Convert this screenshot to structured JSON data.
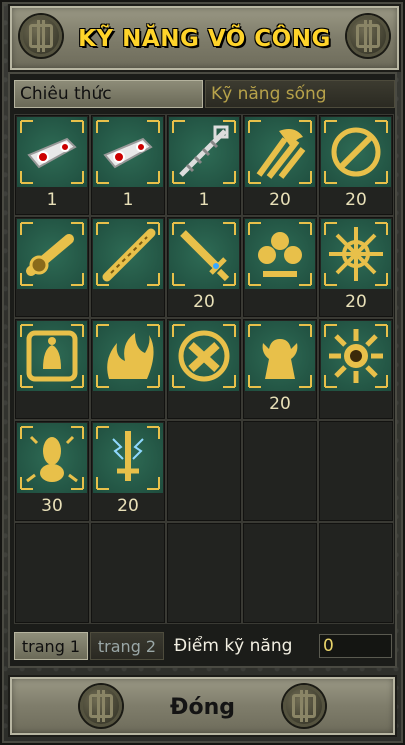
{
  "window": {
    "title": "KỸ NĂNG VÕ CÔNG"
  },
  "tabs": [
    {
      "label": "Chiêu thức",
      "active": true
    },
    {
      "label": "Kỹ năng sống",
      "active": false
    }
  ],
  "skills": [
    {
      "icon": "scroll-icon",
      "level": "1"
    },
    {
      "icon": "scroll-icon",
      "level": "1"
    },
    {
      "icon": "chain-blade-icon",
      "level": "1"
    },
    {
      "icon": "wave-slash-icon",
      "level": "20"
    },
    {
      "icon": "circle-slash-icon",
      "level": "20"
    },
    {
      "icon": "golden-flute-icon",
      "level": ""
    },
    {
      "icon": "staff-icon",
      "level": ""
    },
    {
      "icon": "sword-icon",
      "level": "20"
    },
    {
      "icon": "lotus-icon",
      "level": ""
    },
    {
      "icon": "burst-icon",
      "level": "20"
    },
    {
      "icon": "bell-icon",
      "level": ""
    },
    {
      "icon": "flame-icon",
      "level": ""
    },
    {
      "icon": "cross-circle-icon",
      "level": ""
    },
    {
      "icon": "statue-icon",
      "level": "20"
    },
    {
      "icon": "sun-icon",
      "level": ""
    },
    {
      "icon": "spirit-icon",
      "level": "30"
    },
    {
      "icon": "lightning-sword-icon",
      "level": "20"
    },
    {
      "icon": "",
      "level": ""
    },
    {
      "icon": "",
      "level": ""
    },
    {
      "icon": "",
      "level": ""
    },
    {
      "icon": "",
      "level": ""
    },
    {
      "icon": "",
      "level": ""
    },
    {
      "icon": "",
      "level": ""
    },
    {
      "icon": "",
      "level": ""
    },
    {
      "icon": "",
      "level": ""
    }
  ],
  "pages": [
    {
      "label": "trang 1",
      "active": true
    },
    {
      "label": "trang 2",
      "active": false
    }
  ],
  "skill_points": {
    "label": "Điểm kỹ năng",
    "value": "0"
  },
  "footer": {
    "close_label": "Đóng"
  },
  "colors": {
    "gold": "#ffd42a",
    "teal_bg": "#1f4d3e",
    "icon_gold": "#e8c04a"
  }
}
